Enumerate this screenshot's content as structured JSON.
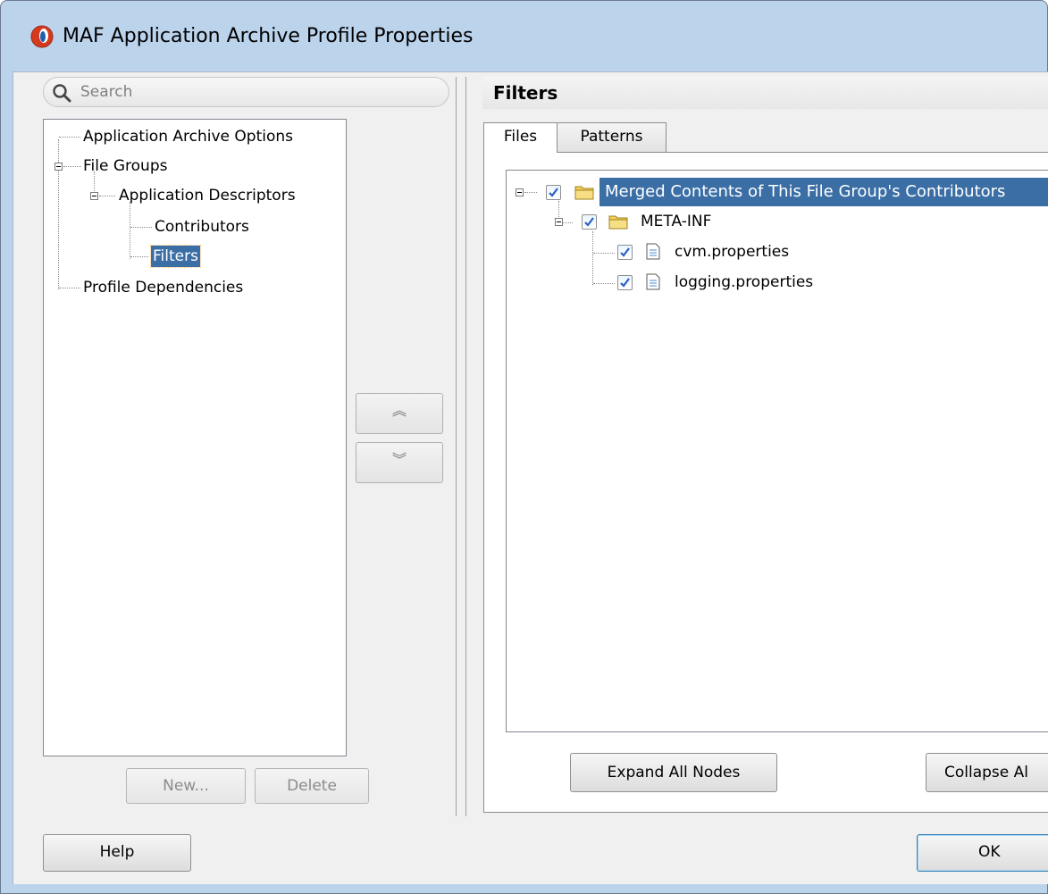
{
  "window": {
    "title": "MAF Application Archive Profile Properties"
  },
  "search": {
    "placeholder": "Search"
  },
  "nav_tree": {
    "items": [
      {
        "label": "Application Archive Options"
      },
      {
        "label": "File Groups"
      },
      {
        "label": "Application Descriptors"
      },
      {
        "label": "Contributors"
      },
      {
        "label": "Filters",
        "selected": true
      },
      {
        "label": "Profile Dependencies"
      }
    ]
  },
  "left_buttons": {
    "new_label": "New...",
    "delete_label": "Delete"
  },
  "move_buttons": {
    "up_glyph": "︽",
    "down_glyph": "︾"
  },
  "panel": {
    "title": "Filters",
    "tabs": [
      {
        "label": "Files",
        "active": true
      },
      {
        "label": "Patterns",
        "active": false
      }
    ]
  },
  "files_tree": {
    "root": {
      "label": "Merged Contents of This File Group's Contributors",
      "checked": true,
      "icon": "folder-icon"
    },
    "folder": {
      "label": "META-INF",
      "checked": true,
      "icon": "folder-icon"
    },
    "files": [
      {
        "label": "cvm.properties",
        "checked": true,
        "icon": "file-icon"
      },
      {
        "label": "logging.properties",
        "checked": true,
        "icon": "file-icon"
      }
    ]
  },
  "tree_buttons": {
    "expand_label": "Expand All Nodes",
    "collapse_label": "Collapse Al"
  },
  "footer": {
    "help_label": "Help",
    "ok_label": "OK"
  },
  "colors": {
    "selection": "#3a6ea5",
    "frame": "#bcd3ec",
    "checkmark": "#2a5fc4"
  }
}
